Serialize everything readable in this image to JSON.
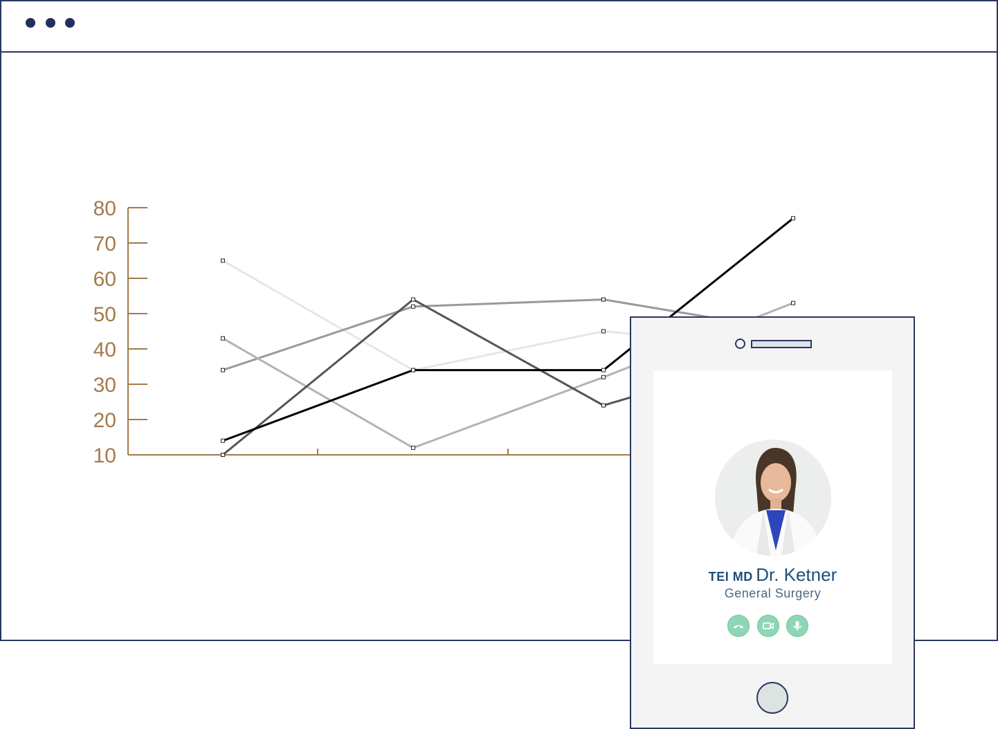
{
  "window": {
    "controls": [
      "dot",
      "dot",
      "dot"
    ]
  },
  "chart_data": {
    "type": "line",
    "y_ticks": [
      "80",
      "70",
      "60",
      "50",
      "40",
      "30",
      "20",
      "10"
    ],
    "ylim": [
      10,
      80
    ],
    "x": [
      1,
      2,
      3,
      4
    ],
    "grid": false,
    "axis_color": "#a47a4a",
    "series": [
      {
        "values": [
          65,
          34,
          45,
          40
        ],
        "color": "#e6e6e6",
        "width": 3
      },
      {
        "values": [
          34,
          52,
          54,
          45
        ],
        "color": "#999999",
        "width": 3
      },
      {
        "values": [
          43,
          12,
          32,
          53
        ],
        "color": "#b3b3b3",
        "width": 3
      },
      {
        "values": [
          10,
          54,
          24,
          40
        ],
        "color": "#555555",
        "width": 3
      },
      {
        "values": [
          14,
          34,
          34,
          77
        ],
        "color": "#000000",
        "width": 3
      }
    ]
  },
  "phone": {
    "brand": "TEI MD",
    "doctor_name": "Dr. Ketner",
    "specialty": "General Surgery",
    "avatar_icon": "doctor-portrait",
    "buttons": [
      {
        "icon": "phone-hangup-icon"
      },
      {
        "icon": "video-camera-icon"
      },
      {
        "icon": "microphone-icon"
      }
    ],
    "accent": "#8fd6b6"
  }
}
